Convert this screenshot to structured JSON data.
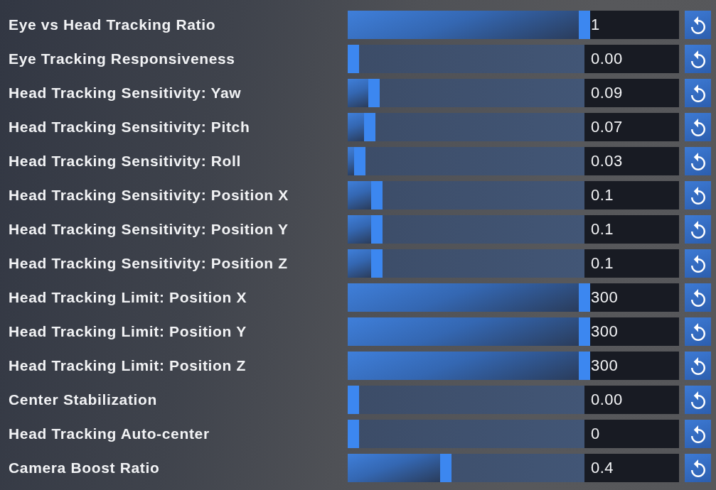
{
  "settings": [
    {
      "label": "Eye vs Head Tracking Ratio",
      "level": 1,
      "value": "1"
    },
    {
      "label": "Eye Tracking Responsiveness",
      "level": 0,
      "value": "0.00"
    },
    {
      "label": "Head Tracking Sensitivity: Yaw",
      "level": 0.088,
      "value": "0.09"
    },
    {
      "label": "Head Tracking Sensitivity: Pitch",
      "level": 0.07,
      "value": "0.07"
    },
    {
      "label": "Head Tracking Sensitivity: Roll",
      "level": 0.027,
      "value": "0.03"
    },
    {
      "label": "Head Tracking Sensitivity: Position X",
      "level": 0.1,
      "value": "0.1"
    },
    {
      "label": "Head Tracking Sensitivity: Position Y",
      "level": 0.1,
      "value": "0.1"
    },
    {
      "label": "Head Tracking Sensitivity: Position Z",
      "level": 0.1,
      "value": "0.1"
    },
    {
      "label": "Head Tracking Limit: Position X",
      "level": 1,
      "value": "300"
    },
    {
      "label": "Head Tracking Limit: Position Y",
      "level": 1,
      "value": "300"
    },
    {
      "label": "Head Tracking Limit: Position Z",
      "level": 1,
      "value": "300"
    },
    {
      "label": "Center Stabilization",
      "level": 0,
      "value": "0.00"
    },
    {
      "label": "Head Tracking Auto-center",
      "level": 0,
      "value": "0"
    },
    {
      "label": "Camera Boost Ratio",
      "level": 0.4,
      "value": "0.4"
    }
  ]
}
